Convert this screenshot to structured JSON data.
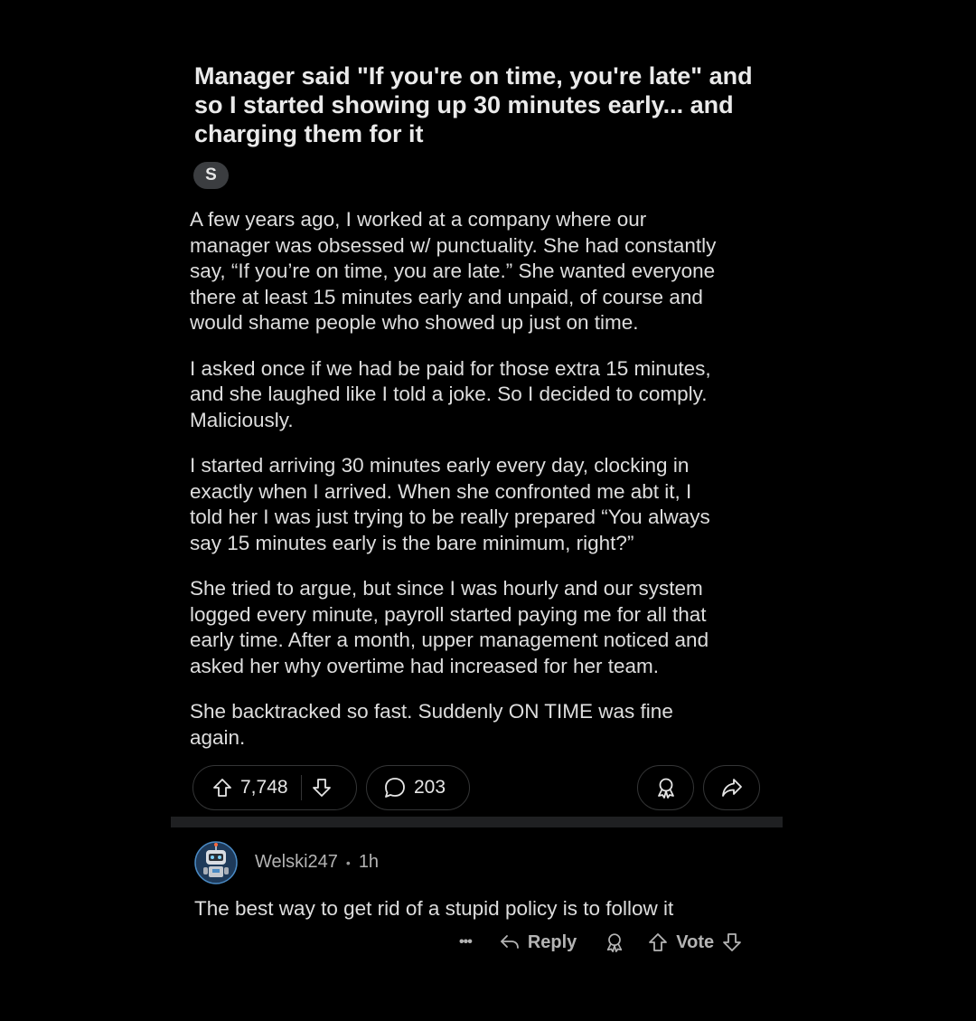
{
  "post": {
    "title": "Manager said \"If you're on time, you're late\" and so I started showing up 30 minutes early... and charging them for it",
    "flair": "S",
    "paragraphs": [
      "A few years ago, I worked at a company where our\nmanager was obsessed w/ punctuality. She had constantly\nsay, “If you’re on time, you are late.” She wanted everyone\nthere at least 15 minutes early and unpaid, of course and\nwould shame people who showed up just on time.",
      "I asked once if we had be paid for those extra 15 minutes,\nand she laughed like I told a joke. So I decided to comply.\nMaliciously.",
      "I started arriving 30 minutes early every day, clocking in\nexactly when I arrived. When she confronted me abt it, I\ntold her I was just trying to be really prepared “You always\nsay 15 minutes early is the bare minimum, right?”",
      "She tried to argue, but since I was hourly and our system\nlogged every minute, payroll started paying me for all that\nearly time. After a month, upper management noticed and\nasked her why overtime had increased for her team.",
      "She backtracked so fast. Suddenly ON TIME was fine\nagain."
    ],
    "upvote_count": "7,748",
    "comment_count": "203",
    "icons": {
      "upvote": "arrow-up-icon",
      "downvote": "arrow-down-icon",
      "comments": "speech-bubble-icon",
      "award": "award-ribbon-icon",
      "share": "share-arrow-icon"
    }
  },
  "comment": {
    "username": "Welski247",
    "separator": "•",
    "time": "1h",
    "text": "The best way to get rid of a stupid policy is to follow it",
    "more_label": "•••",
    "reply_label": "Reply",
    "vote_label": "Vote",
    "avatar_icon": "robot-avatar-icon"
  },
  "colors": {
    "background": "#000000",
    "text_primary": "#dedede",
    "text_secondary": "#b4b4b4",
    "pill_border": "#343536",
    "flair_bg": "#3b3d40",
    "separator": "#1f2022"
  }
}
